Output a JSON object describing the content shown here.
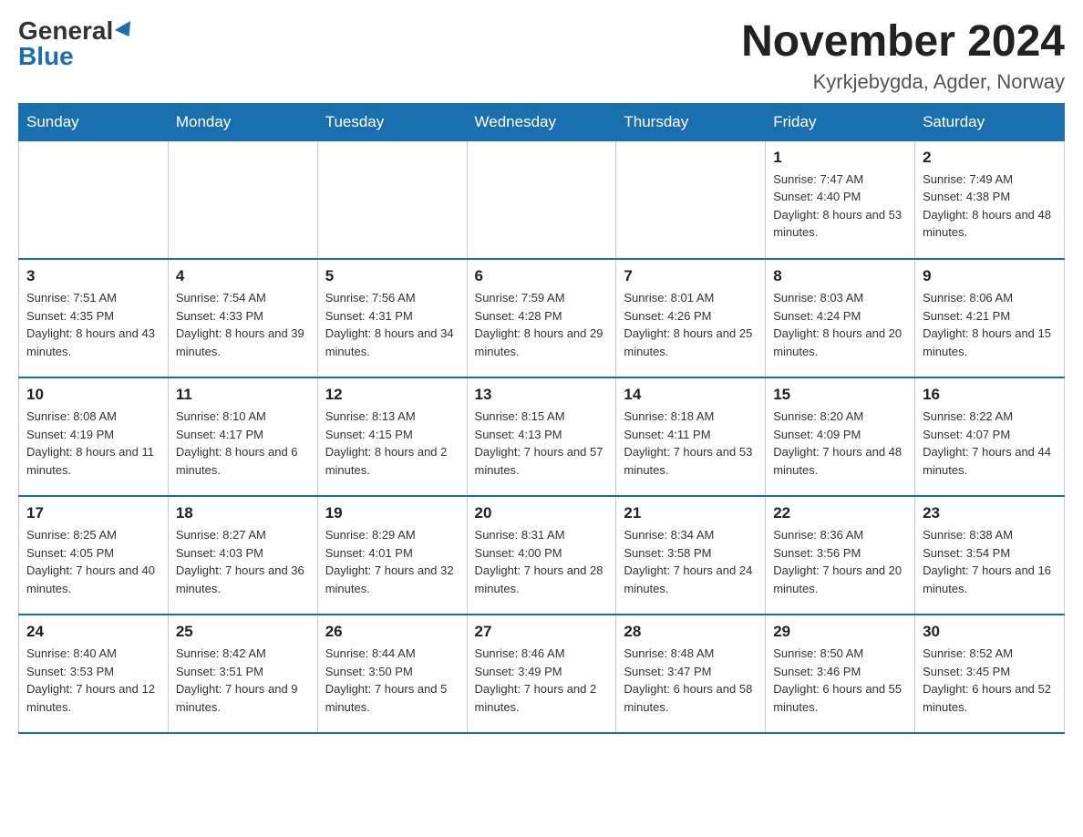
{
  "header": {
    "logo_general": "General",
    "logo_blue": "Blue",
    "title": "November 2024",
    "subtitle": "Kyrkjebygda, Agder, Norway"
  },
  "weekdays": [
    "Sunday",
    "Monday",
    "Tuesday",
    "Wednesday",
    "Thursday",
    "Friday",
    "Saturday"
  ],
  "weeks": [
    [
      {
        "day": "",
        "info": ""
      },
      {
        "day": "",
        "info": ""
      },
      {
        "day": "",
        "info": ""
      },
      {
        "day": "",
        "info": ""
      },
      {
        "day": "",
        "info": ""
      },
      {
        "day": "1",
        "info": "Sunrise: 7:47 AM\nSunset: 4:40 PM\nDaylight: 8 hours and 53 minutes."
      },
      {
        "day": "2",
        "info": "Sunrise: 7:49 AM\nSunset: 4:38 PM\nDaylight: 8 hours and 48 minutes."
      }
    ],
    [
      {
        "day": "3",
        "info": "Sunrise: 7:51 AM\nSunset: 4:35 PM\nDaylight: 8 hours and 43 minutes."
      },
      {
        "day": "4",
        "info": "Sunrise: 7:54 AM\nSunset: 4:33 PM\nDaylight: 8 hours and 39 minutes."
      },
      {
        "day": "5",
        "info": "Sunrise: 7:56 AM\nSunset: 4:31 PM\nDaylight: 8 hours and 34 minutes."
      },
      {
        "day": "6",
        "info": "Sunrise: 7:59 AM\nSunset: 4:28 PM\nDaylight: 8 hours and 29 minutes."
      },
      {
        "day": "7",
        "info": "Sunrise: 8:01 AM\nSunset: 4:26 PM\nDaylight: 8 hours and 25 minutes."
      },
      {
        "day": "8",
        "info": "Sunrise: 8:03 AM\nSunset: 4:24 PM\nDaylight: 8 hours and 20 minutes."
      },
      {
        "day": "9",
        "info": "Sunrise: 8:06 AM\nSunset: 4:21 PM\nDaylight: 8 hours and 15 minutes."
      }
    ],
    [
      {
        "day": "10",
        "info": "Sunrise: 8:08 AM\nSunset: 4:19 PM\nDaylight: 8 hours and 11 minutes."
      },
      {
        "day": "11",
        "info": "Sunrise: 8:10 AM\nSunset: 4:17 PM\nDaylight: 8 hours and 6 minutes."
      },
      {
        "day": "12",
        "info": "Sunrise: 8:13 AM\nSunset: 4:15 PM\nDaylight: 8 hours and 2 minutes."
      },
      {
        "day": "13",
        "info": "Sunrise: 8:15 AM\nSunset: 4:13 PM\nDaylight: 7 hours and 57 minutes."
      },
      {
        "day": "14",
        "info": "Sunrise: 8:18 AM\nSunset: 4:11 PM\nDaylight: 7 hours and 53 minutes."
      },
      {
        "day": "15",
        "info": "Sunrise: 8:20 AM\nSunset: 4:09 PM\nDaylight: 7 hours and 48 minutes."
      },
      {
        "day": "16",
        "info": "Sunrise: 8:22 AM\nSunset: 4:07 PM\nDaylight: 7 hours and 44 minutes."
      }
    ],
    [
      {
        "day": "17",
        "info": "Sunrise: 8:25 AM\nSunset: 4:05 PM\nDaylight: 7 hours and 40 minutes."
      },
      {
        "day": "18",
        "info": "Sunrise: 8:27 AM\nSunset: 4:03 PM\nDaylight: 7 hours and 36 minutes."
      },
      {
        "day": "19",
        "info": "Sunrise: 8:29 AM\nSunset: 4:01 PM\nDaylight: 7 hours and 32 minutes."
      },
      {
        "day": "20",
        "info": "Sunrise: 8:31 AM\nSunset: 4:00 PM\nDaylight: 7 hours and 28 minutes."
      },
      {
        "day": "21",
        "info": "Sunrise: 8:34 AM\nSunset: 3:58 PM\nDaylight: 7 hours and 24 minutes."
      },
      {
        "day": "22",
        "info": "Sunrise: 8:36 AM\nSunset: 3:56 PM\nDaylight: 7 hours and 20 minutes."
      },
      {
        "day": "23",
        "info": "Sunrise: 8:38 AM\nSunset: 3:54 PM\nDaylight: 7 hours and 16 minutes."
      }
    ],
    [
      {
        "day": "24",
        "info": "Sunrise: 8:40 AM\nSunset: 3:53 PM\nDaylight: 7 hours and 12 minutes."
      },
      {
        "day": "25",
        "info": "Sunrise: 8:42 AM\nSunset: 3:51 PM\nDaylight: 7 hours and 9 minutes."
      },
      {
        "day": "26",
        "info": "Sunrise: 8:44 AM\nSunset: 3:50 PM\nDaylight: 7 hours and 5 minutes."
      },
      {
        "day": "27",
        "info": "Sunrise: 8:46 AM\nSunset: 3:49 PM\nDaylight: 7 hours and 2 minutes."
      },
      {
        "day": "28",
        "info": "Sunrise: 8:48 AM\nSunset: 3:47 PM\nDaylight: 6 hours and 58 minutes."
      },
      {
        "day": "29",
        "info": "Sunrise: 8:50 AM\nSunset: 3:46 PM\nDaylight: 6 hours and 55 minutes."
      },
      {
        "day": "30",
        "info": "Sunrise: 8:52 AM\nSunset: 3:45 PM\nDaylight: 6 hours and 52 minutes."
      }
    ]
  ]
}
